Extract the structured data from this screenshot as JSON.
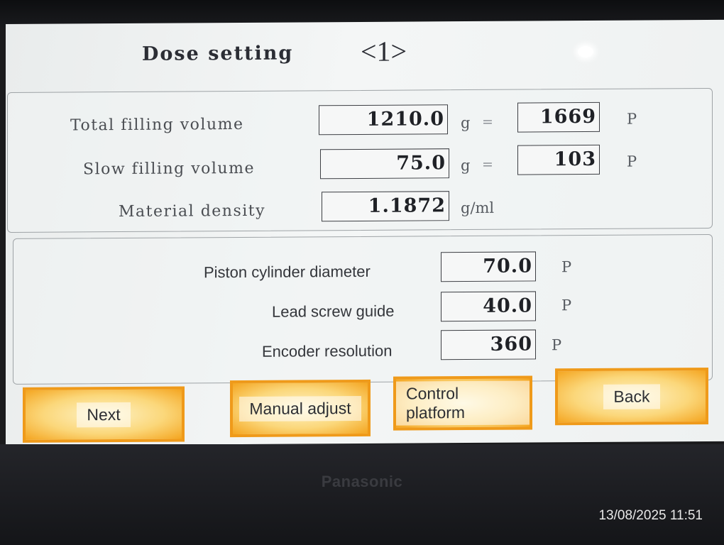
{
  "screen": {
    "title": "Dose setting",
    "page_indicator": "<1>"
  },
  "dose_panel": {
    "total_filling_volume": {
      "label": "Total filling volume",
      "value": "1210.0",
      "unit": "g",
      "equals": "=",
      "pulse_value": "1669",
      "pulse_unit": "P"
    },
    "slow_filling_volume": {
      "label": "Slow filling volume",
      "value": "75.0",
      "unit": "g",
      "equals": "=",
      "pulse_value": "103",
      "pulse_unit": "P"
    },
    "material_density": {
      "label": "Material density",
      "value": "1.1872",
      "unit": "g/ml"
    }
  },
  "mechanics_panel": {
    "piston_cylinder_diameter": {
      "label": "Piston cylinder diameter",
      "value": "70.0",
      "unit": "P"
    },
    "lead_screw_guide": {
      "label": "Lead screw guide",
      "value": "40.0",
      "unit": "P"
    },
    "encoder_resolution": {
      "label": "Encoder resolution",
      "value": "360",
      "unit": "P"
    }
  },
  "buttons": {
    "next": "Next",
    "manual_adjust": "Manual adjust",
    "control_platform": "Control platform",
    "back": "Back"
  },
  "device": {
    "brand": "Panasonic"
  },
  "photo": {
    "timestamp": "13/08/2025 11:51"
  },
  "colors": {
    "button_accent": "#ef9a1a",
    "screen_background": "#eef1f1"
  }
}
